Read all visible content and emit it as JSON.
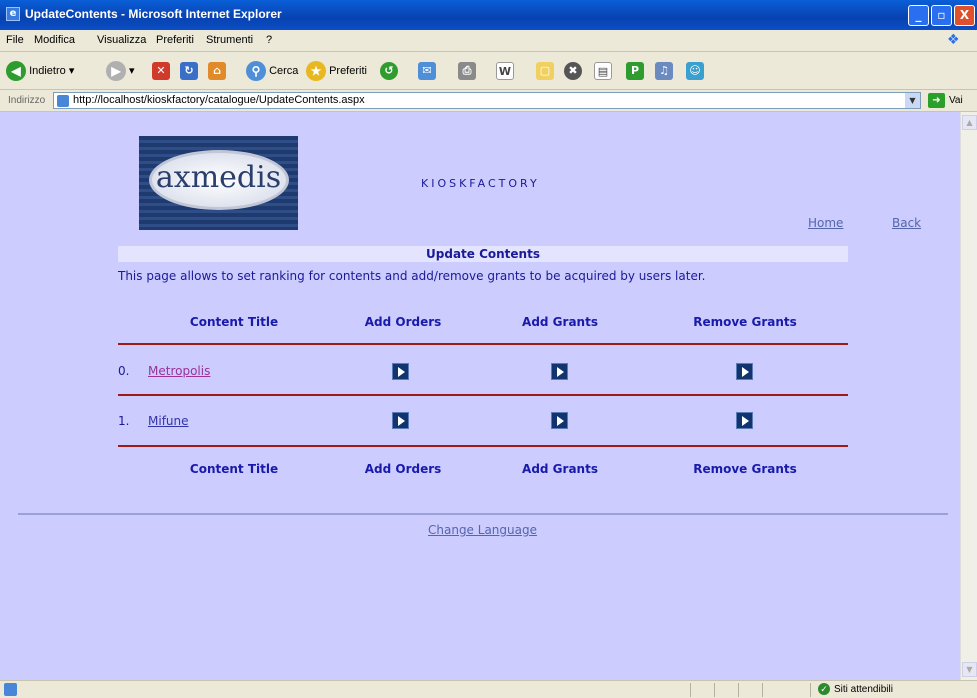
{
  "window": {
    "title": "UpdateContents - Microsoft Internet Explorer",
    "minimize": "_",
    "maximize": "▫",
    "close": "X"
  },
  "menu": [
    "File",
    "Modifica",
    "Visualizza",
    "Preferiti",
    "Strumenti",
    "?"
  ],
  "toolbar": {
    "back_label": "Indietro",
    "search_label": "Cerca",
    "favorites_label": "Preferiti"
  },
  "address": {
    "label": "Indirizzo",
    "url": "http://localhost/kioskfactory/catalogue/UpdateContents.aspx",
    "go_label": "Vai"
  },
  "page": {
    "logo_text": "axmedis",
    "brand": "KIOSKFACTORY",
    "home_link": "Home",
    "back_link": "Back",
    "heading": "Update Contents",
    "description": "This page allows to set ranking for contents and add/remove grants to be acquired by users later.",
    "columns": [
      "Content Title",
      "Add Orders",
      "Add Grants",
      "Remove Grants"
    ],
    "rows": [
      {
        "index": "0.",
        "title": "Metropolis",
        "title_color": "#993399"
      },
      {
        "index": "1.",
        "title": "Mifune",
        "title_color": "#3333aa"
      }
    ],
    "change_language": "Change Language"
  },
  "status": {
    "zone": "Siti attendibili"
  },
  "colors": {
    "page_bg": "#ccccff",
    "text": "#1a1a99",
    "rule": "#a01818",
    "link": "#5566aa"
  }
}
